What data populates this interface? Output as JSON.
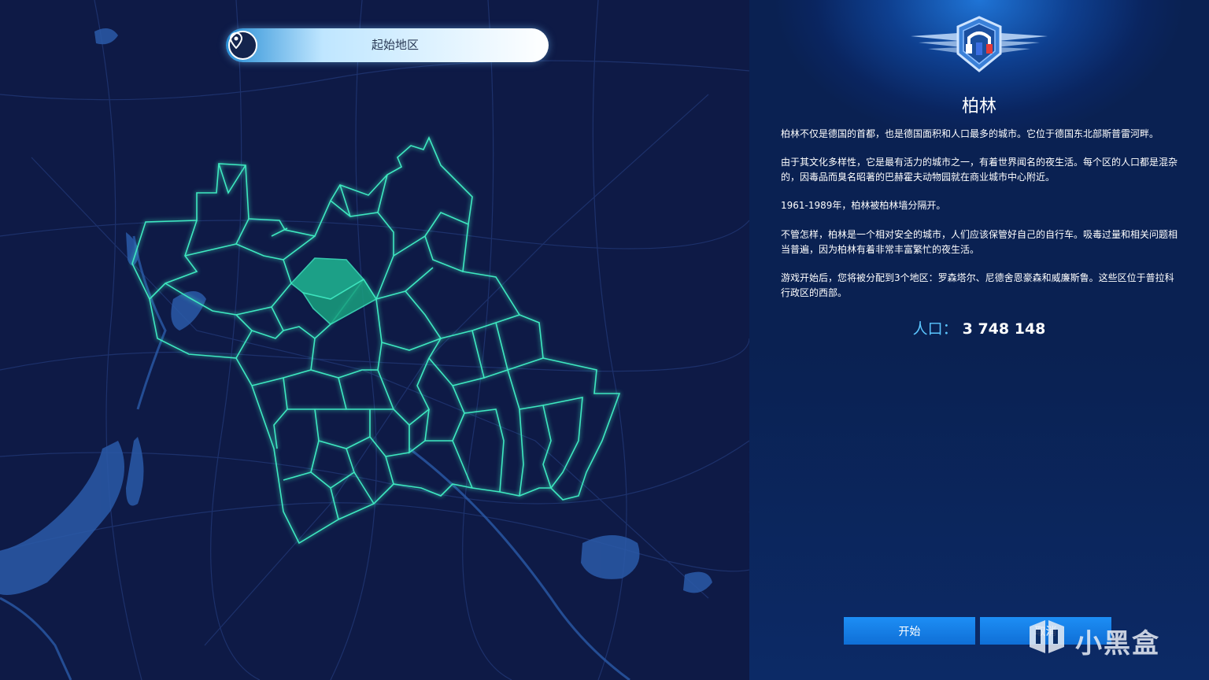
{
  "map": {
    "region_selector": {
      "label": "起始地区",
      "icon": "location-pin-icon"
    },
    "colors": {
      "background": "#0e1a46",
      "district_outline": "#3ee8c0",
      "selected_fill": "#1fb893",
      "water": "#2a5aa8"
    }
  },
  "panel": {
    "emblem_icon": "winged-shield-emblem-icon",
    "city_name": "柏林",
    "paragraphs": [
      "柏林不仅是德国的首都，也是德国面积和人口最多的城市。它位于德国东北部斯普雷河畔。",
      "由于其文化多样性，它是最有活力的城市之一，有着世界闻名的夜生活。每个区的人口都是混杂的，因毒品而臭名昭著的巴赫霍夫动物园就在商业城市中心附近。",
      "1961-1989年，柏林被柏林墙分隔开。",
      "不管怎样，柏林是一个相对安全的城市，人们应该保管好自己的自行车。吸毒过量和相关问题相当普遍，因为柏林有着非常丰富繁忙的夜生活。",
      "游戏开始后，您将被分配到3个地区：罗森塔尔、尼德舍恩豪森和威廉斯鲁。这些区位于普拉科行政区的西部。"
    ],
    "population_label": "人口：",
    "population_value": "3 748 148",
    "buttons": {
      "start": "开始",
      "cancel": "取消"
    }
  },
  "watermark": {
    "text": "小黑盒",
    "icon": "xiaoheihe-logo-icon"
  }
}
